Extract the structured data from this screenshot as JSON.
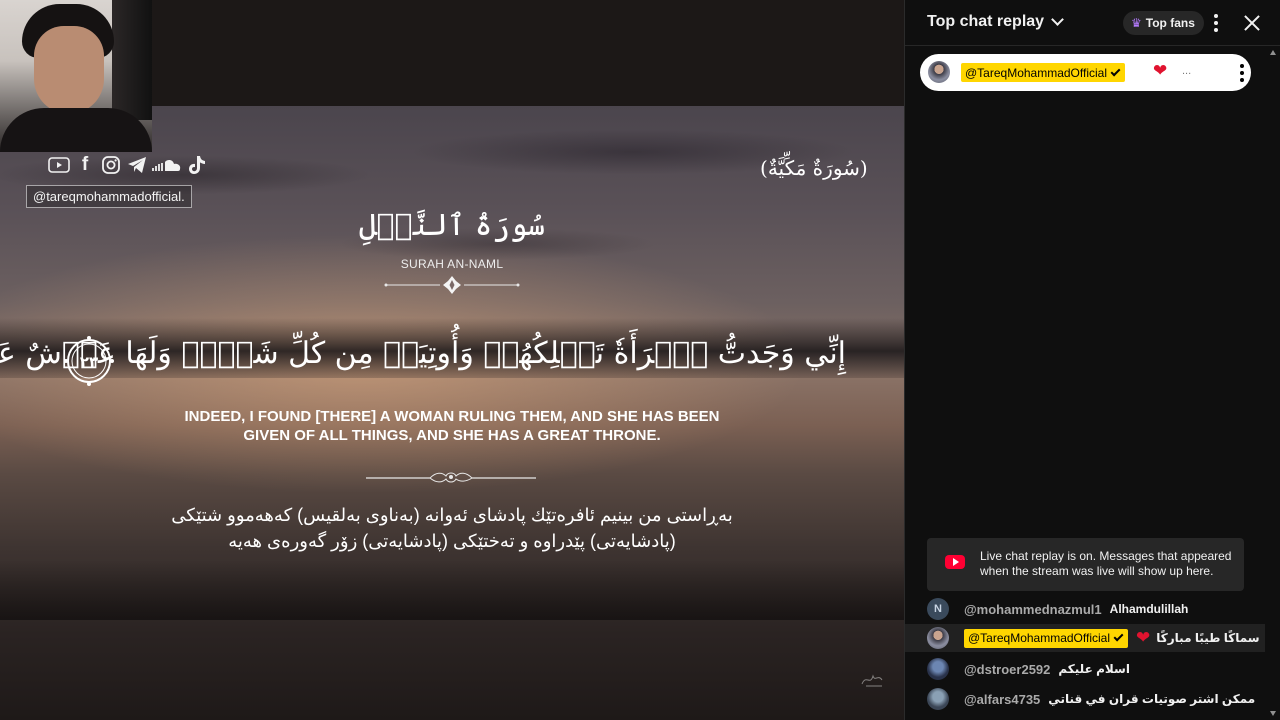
{
  "video": {
    "social_handle": "@tareqmohammadofficial.",
    "socials": [
      "youtube-icon",
      "facebook-icon",
      "instagram-icon",
      "telegram-icon",
      "soundcloud-icon",
      "tiktok-icon"
    ],
    "makkiyah": "(سُورَةٌ مَكِّيَّةٌ)",
    "surah_arabic": "سُورَةُ ٱلنَّمۡلِ",
    "surah_latin": "SURAH AN-NAML",
    "verse_arabic": "إِنِّي وَجَدتُّ ٱمۡرَأَةٗ تَمۡلِكُهُمۡ وَأُوتِيَتۡ مِن كُلِّ شَيۡءٖ وَلَهَا عَرۡشٌ عَظِيمٞ",
    "verse_number": "٢٣",
    "translation_line1": "INDEED, I FOUND [THERE] A WOMAN RULING THEM, AND SHE HAS BEEN",
    "translation_line2": "GIVEN OF ALL THINGS, AND SHE HAS A GREAT THRONE.",
    "kurdish_line1": "بەڕاستی من بینیم ئافرەتێك پادشای ئەوانە (بەناوی بەلقیس) کەهەموو شتێکی",
    "kurdish_line2": "(پادشایەتی) پێدراوە و تەختێکی (پادشایەتی) زۆر گەورەی هەیە"
  },
  "chat": {
    "title": "Top chat replay",
    "top_fans": "Top fans",
    "pinned": {
      "author": "@TareqMohammadOfficial",
      "trail": "..."
    },
    "notice": "Live chat replay is on. Messages that appeared when the stream was live will show up here.",
    "messages": [
      {
        "initial": "N",
        "author": "@mohammednazmul1",
        "text": "Alhamdulillah"
      },
      {
        "author": "@TareqMohammadOfficial",
        "text": "سماكًا طيبًا مباركًا"
      },
      {
        "author": "@dstroer2592",
        "text": "اسلام عليكم"
      },
      {
        "author": "@alfars4735",
        "text": "ممكن اشتر صوتيات قران في قناتي"
      }
    ]
  },
  "colors": {
    "owner_chip": "#ffd600",
    "heart": "#e0132f",
    "youtube_red": "#ff0033",
    "top_fans_crown": "#b57bff"
  }
}
